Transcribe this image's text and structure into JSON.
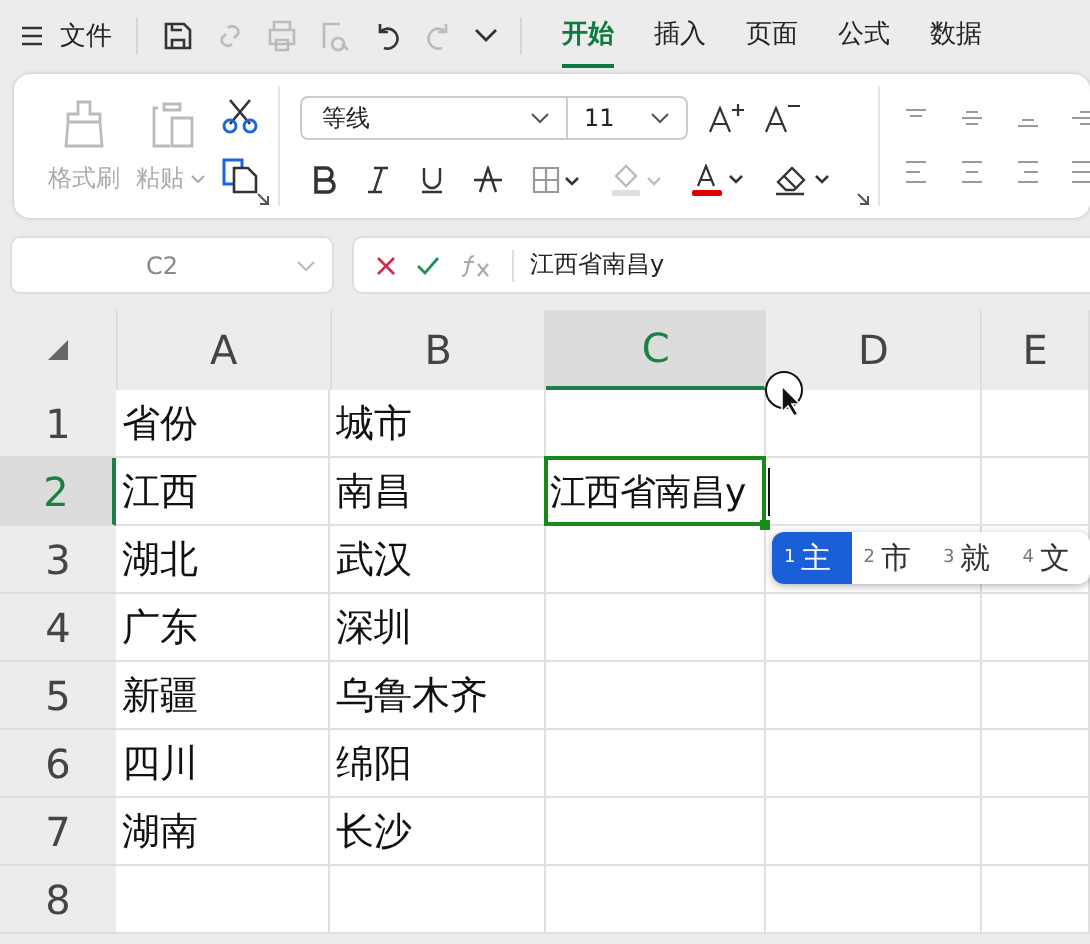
{
  "file_menu": {
    "label": "文件"
  },
  "tabs": [
    {
      "label": "开始",
      "selected": true
    },
    {
      "label": "插入",
      "selected": false
    },
    {
      "label": "页面",
      "selected": false
    },
    {
      "label": "公式",
      "selected": false
    },
    {
      "label": "数据",
      "selected": false
    }
  ],
  "ribbon": {
    "format_painter": "格式刷",
    "paste": "粘贴",
    "font": "等线",
    "font_size": "11"
  },
  "name_box": "C2",
  "formula": "江西省南昌y",
  "columns": [
    {
      "label": "A",
      "selected": false
    },
    {
      "label": "B",
      "selected": false
    },
    {
      "label": "C",
      "selected": true
    },
    {
      "label": "D",
      "selected": false
    },
    {
      "label": "E",
      "selected": false
    }
  ],
  "rows": [
    {
      "label": "1",
      "selected": false,
      "cells": [
        {
          "text": "省份"
        },
        {
          "text": "城市"
        }
      ]
    },
    {
      "label": "2",
      "selected": true,
      "cells": [
        {
          "text": "江西"
        },
        {
          "text": "南昌"
        },
        {
          "text": "江西省南昌y",
          "editing": true
        }
      ]
    },
    {
      "label": "3",
      "selected": false,
      "cells": [
        {
          "text": "湖北"
        },
        {
          "text": "武汉"
        }
      ]
    },
    {
      "label": "4",
      "selected": false,
      "cells": [
        {
          "text": "广东"
        },
        {
          "text": "深圳"
        }
      ]
    },
    {
      "label": "5",
      "selected": false,
      "cells": [
        {
          "text": "新疆"
        },
        {
          "text": "乌鲁木齐"
        }
      ]
    },
    {
      "label": "6",
      "selected": false,
      "cells": [
        {
          "text": "四川"
        },
        {
          "text": "绵阳"
        }
      ]
    },
    {
      "label": "7",
      "selected": false,
      "cells": [
        {
          "text": "湖南"
        },
        {
          "text": "长沙"
        }
      ]
    },
    {
      "label": "8",
      "selected": false,
      "cells": []
    }
  ],
  "candidates": [
    {
      "number": "1",
      "text": "主",
      "selected": true
    },
    {
      "number": "2",
      "text": "市",
      "selected": false
    },
    {
      "number": "3",
      "text": "就",
      "selected": false
    },
    {
      "number": "4",
      "text": "文",
      "selected": false
    }
  ]
}
